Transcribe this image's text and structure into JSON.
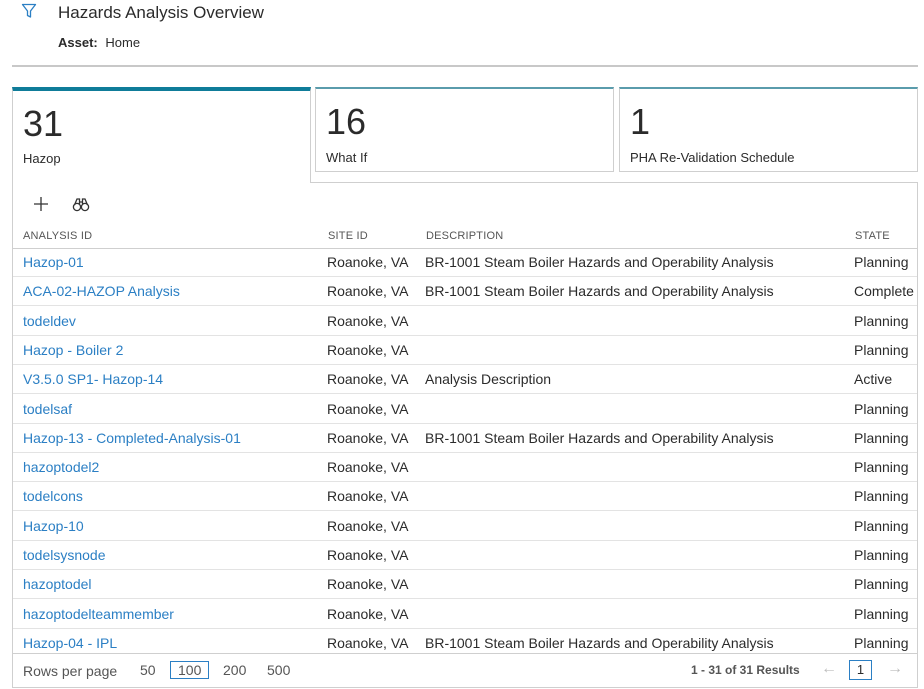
{
  "header": {
    "title": "Hazards Analysis Overview",
    "asset_label": "Asset:",
    "asset_value": "Home"
  },
  "cards": [
    {
      "count": "31",
      "label": "Hazop"
    },
    {
      "count": "16",
      "label": "What If"
    },
    {
      "count": "1",
      "label": "PHA Re-Validation Schedule"
    }
  ],
  "table": {
    "columns": [
      "ANALYSIS ID",
      "SITE ID",
      "DESCRIPTION",
      "STATE"
    ],
    "rows": [
      {
        "id": "Hazop-01",
        "site": "Roanoke, VA",
        "description": "BR-1001 Steam Boiler Hazards and Operability Analysis",
        "state": "Planning"
      },
      {
        "id": "ACA-02-HAZOP Analysis",
        "site": "Roanoke, VA",
        "description": "BR-1001 Steam Boiler Hazards and Operability Analysis",
        "state": "Complete"
      },
      {
        "id": "todeldev",
        "site": "Roanoke, VA",
        "description": "",
        "state": "Planning"
      },
      {
        "id": "Hazop - Boiler 2",
        "site": "Roanoke, VA",
        "description": "",
        "state": "Planning"
      },
      {
        "id": "V3.5.0 SP1- Hazop-14",
        "site": "Roanoke, VA",
        "description": "Analysis Description",
        "state": "Active"
      },
      {
        "id": "todelsaf",
        "site": "Roanoke, VA",
        "description": "",
        "state": "Planning"
      },
      {
        "id": "Hazop-13 - Completed-Analysis-01",
        "site": "Roanoke, VA",
        "description": "BR-1001 Steam Boiler Hazards and Operability Analysis",
        "state": "Planning"
      },
      {
        "id": "hazoptodel2",
        "site": "Roanoke, VA",
        "description": "",
        "state": "Planning"
      },
      {
        "id": "todelcons",
        "site": "Roanoke, VA",
        "description": "",
        "state": "Planning"
      },
      {
        "id": "Hazop-10",
        "site": "Roanoke, VA",
        "description": "",
        "state": "Planning"
      },
      {
        "id": "todelsysnode",
        "site": "Roanoke, VA",
        "description": "",
        "state": "Planning"
      },
      {
        "id": "hazoptodel",
        "site": "Roanoke, VA",
        "description": "",
        "state": "Planning"
      },
      {
        "id": "hazoptodelteammember",
        "site": "Roanoke, VA",
        "description": "",
        "state": "Planning"
      },
      {
        "id": "Hazop-04 - IPL",
        "site": "Roanoke, VA",
        "description": "BR-1001 Steam Boiler Hazards and Operability Analysis",
        "state": "Planning"
      }
    ]
  },
  "footer": {
    "rows_per_page_label": "Rows per page",
    "options": [
      "50",
      "100",
      "200",
      "500"
    ],
    "selected_option": "100",
    "results": "1 - 31 of 31 Results",
    "current_page": "1"
  },
  "icons": [
    "filter-icon",
    "add-icon",
    "binoculars-icon",
    "arrow-left-icon",
    "arrow-right-icon"
  ],
  "colors": {
    "accent": "#0f7c99",
    "link": "#2b7fc4"
  }
}
